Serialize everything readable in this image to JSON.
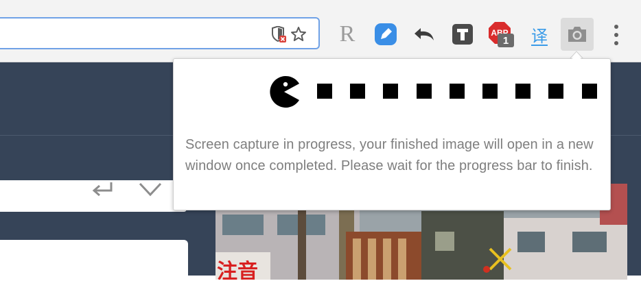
{
  "popup": {
    "message": "Screen capture in progress, your finished image will open in a new window once completed. Please wait for the progress bar to finish.",
    "progress_steps_total": 9,
    "progress_steps_remaining": 9
  },
  "toolbar": {
    "extensions": [
      {
        "name": "reader-extension",
        "glyph": "R"
      },
      {
        "name": "edit-extension"
      },
      {
        "name": "undo-extension"
      },
      {
        "name": "text-extension",
        "glyph": "T"
      },
      {
        "name": "adblock-extension",
        "glyph": "ABP",
        "badge": "1"
      },
      {
        "name": "translate-extension",
        "glyph": "译"
      },
      {
        "name": "screenshot-extension"
      }
    ]
  },
  "photo": {
    "visible_sign_text": "注音"
  },
  "colors": {
    "page_header": "#364458",
    "omnibox_border": "#6fa1e6",
    "popup_text": "#7e7e7e",
    "edit_extension": "#3a8ee6",
    "adblock": "#d92c2c",
    "translate": "#3a9be8"
  }
}
